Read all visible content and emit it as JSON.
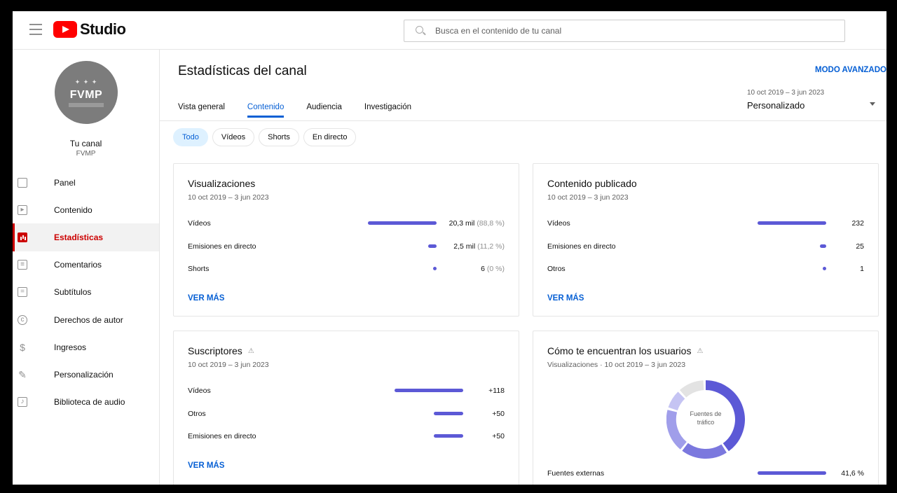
{
  "app": {
    "logo_text": "Studio"
  },
  "search": {
    "placeholder": "Busca en el contenido de tu canal"
  },
  "channel": {
    "avatar_text": "FVMP",
    "title": "Tu canal",
    "name": "FVMP"
  },
  "sidebar": {
    "items": [
      {
        "label": "Panel",
        "icon": "dashboard-icon"
      },
      {
        "label": "Contenido",
        "icon": "content-icon"
      },
      {
        "label": "Estadísticas",
        "icon": "analytics-icon",
        "active": true
      },
      {
        "label": "Comentarios",
        "icon": "comments-icon"
      },
      {
        "label": "Subtítulos",
        "icon": "subtitles-icon"
      },
      {
        "label": "Derechos de autor",
        "icon": "copyright-icon"
      },
      {
        "label": "Ingresos",
        "icon": "earn-icon"
      },
      {
        "label": "Personalización",
        "icon": "customization-icon"
      },
      {
        "label": "Biblioteca de audio",
        "icon": "audio-library-icon"
      }
    ]
  },
  "page": {
    "title": "Estadísticas del canal",
    "advanced_mode": "MODO AVANZADO",
    "date_range": "10 oct 2019 – 3 jun 2023",
    "date_preset": "Personalizado",
    "tabs": [
      "Vista general",
      "Contenido",
      "Audiencia",
      "Investigación"
    ],
    "active_tab": "Contenido",
    "chips": [
      "Todo",
      "Vídeos",
      "Shorts",
      "En directo"
    ],
    "active_chip": "Todo"
  },
  "cards": {
    "views": {
      "title": "Visualizaciones",
      "subtitle": "10 oct 2019 – 3 jun 2023",
      "rows": [
        {
          "label": "Vídeos",
          "value": "20,3 mil",
          "pct": "(88,8 %)",
          "share": 0.888
        },
        {
          "label": "Emisiones en directo",
          "value": "2,5 mil",
          "pct": "(11,2 %)",
          "share": 0.112
        },
        {
          "label": "Shorts",
          "value": "6",
          "pct": "(0 %)",
          "share": 0
        }
      ],
      "more": "VER MÁS"
    },
    "published": {
      "title": "Contenido publicado",
      "subtitle": "10 oct 2019 – 3 jun 2023",
      "rows": [
        {
          "label": "Vídeos",
          "value": "232",
          "share": 1
        },
        {
          "label": "Emisiones en directo",
          "value": "25",
          "share": 0.108
        },
        {
          "label": "Otros",
          "value": "1",
          "share": 0.004
        }
      ],
      "more": "VER MÁS"
    },
    "subscribers": {
      "title": "Suscriptores",
      "subtitle": "10 oct 2019 – 3 jun 2023",
      "rows": [
        {
          "label": "Vídeos",
          "value": "+118",
          "share": 1
        },
        {
          "label": "Otros",
          "value": "+50",
          "share": 0.424
        },
        {
          "label": "Emisiones en directo",
          "value": "+50",
          "share": 0.424
        }
      ],
      "more": "VER MÁS"
    },
    "traffic": {
      "title": "Cómo te encuentran los usuarios",
      "subtitle": "Visualizaciones · 10 oct 2019 – 3 jun 2023",
      "donut_label_line1": "Fuentes de",
      "donut_label_line2": "tráfico",
      "rows": [
        {
          "label": "Fuentes externas",
          "value": "41,6 %",
          "share": 0.416
        }
      ]
    }
  },
  "colors": {
    "accent": "#065fd4",
    "bar": "#5c59d6",
    "active_nav": "#cc0000"
  }
}
